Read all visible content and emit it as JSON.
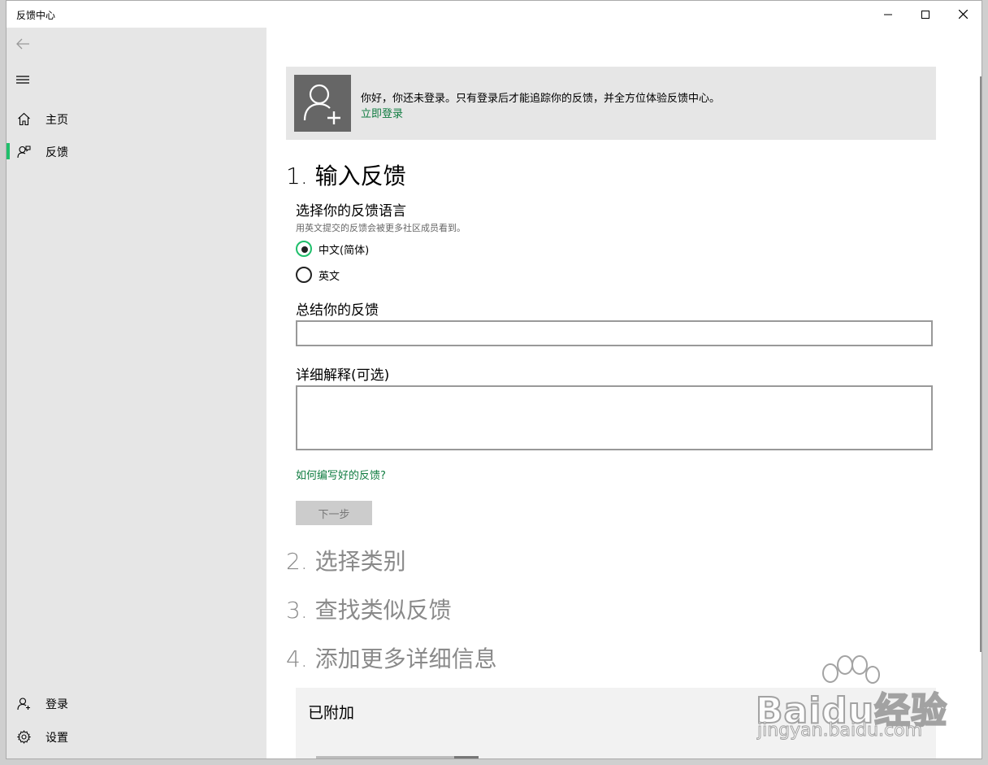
{
  "window": {
    "title": "反馈中心"
  },
  "sidebar": {
    "items": [
      {
        "label": "主页",
        "icon": "home-icon"
      },
      {
        "label": "反馈",
        "icon": "feedback-icon",
        "selected": true
      }
    ],
    "bottom_items": [
      {
        "label": "登录",
        "icon": "person-add-icon"
      },
      {
        "label": "设置",
        "icon": "gear-icon"
      }
    ],
    "selected_color": "#1fbf6b"
  },
  "signin_banner": {
    "message": "你好，你还未登录。只有登录后才能追踪你的反馈，并全方位体验反馈中心。",
    "link": "立即登录"
  },
  "steps": [
    {
      "title": "1. 输入反馈",
      "active": true
    },
    {
      "title": "2. 选择类别",
      "active": false
    },
    {
      "title": "3. 查找类似反馈",
      "active": false
    },
    {
      "title": "4. 添加更多详细信息",
      "active": false
    }
  ],
  "language": {
    "label": "选择你的反馈语言",
    "hint": "用英文提交的反馈会被更多社区成员看到。",
    "options": [
      "中文(简体)",
      "英文"
    ],
    "selected": "中文(简体)"
  },
  "summary": {
    "label": "总结你的反馈",
    "value": ""
  },
  "details": {
    "label": "详细解释(可选)",
    "value": ""
  },
  "help_link": "如何编写好的反馈?",
  "next_button": "下一步",
  "attachments": {
    "title": "已附加"
  },
  "watermark": {
    "brand": "Baidu经验",
    "url": "jingyan.baidu.com"
  },
  "colors": {
    "accent": "#1fbf6b",
    "link": "#107c41",
    "sidebar_bg": "#e6e6e6"
  }
}
